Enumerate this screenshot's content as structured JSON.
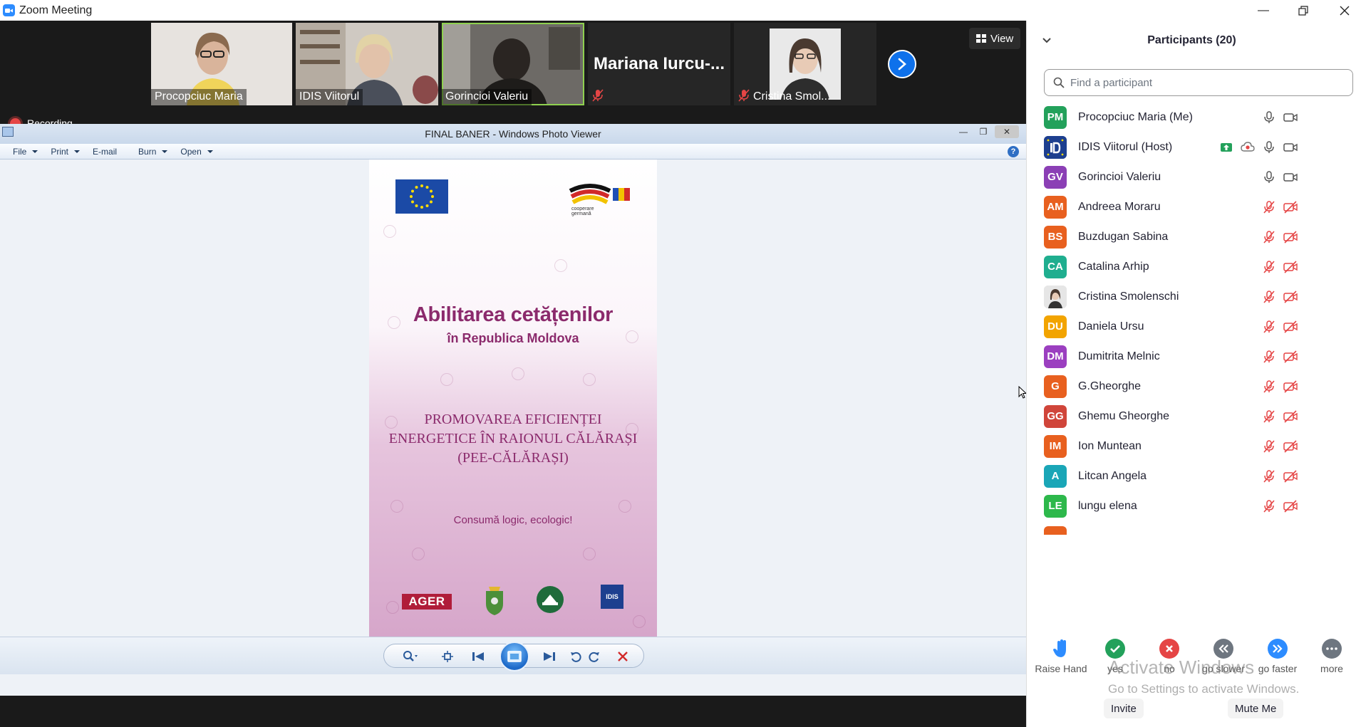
{
  "window": {
    "title": "Zoom Meeting"
  },
  "videos": [
    {
      "name": "Procopciuc Maria"
    },
    {
      "name": "IDIS Viitorul"
    },
    {
      "name": "Gorincioi Valeriu"
    },
    {
      "name": "Mariana Iurcu-..."
    },
    {
      "name": "Cristina Smol..."
    }
  ],
  "view_label": "View",
  "recording_label": "Recording",
  "photo_viewer": {
    "title": "FINAL BANER - Windows Photo Viewer",
    "menu": [
      "File",
      "Print",
      "E-mail",
      "Burn",
      "Open"
    ]
  },
  "poster": {
    "title": "Abilitarea cetățenilor",
    "subtitle": "în Republica Moldova",
    "project": "PROMOVAREA EFICIENȚEI ENERGETICE ÎN RAIONUL CĂLĂRAȘI (PEE-CĂLĂRAȘI)",
    "slogan": "Consumă logic, ecologic!",
    "ager": "AGER",
    "idis": "IDIS",
    "coop_line1": "cooperare",
    "coop_line2": "germană"
  },
  "participants_panel": {
    "title": "Participants (20)",
    "search_placeholder": "Find a participant",
    "participants": [
      {
        "initials": "PM",
        "name": "Procopciuc Maria (Me)",
        "color": "#23a15b",
        "muted": false,
        "video": true
      },
      {
        "initials": "",
        "name": "IDIS Viitorul (Host)",
        "color": "#1d3f8f",
        "muted": false,
        "video": true,
        "sharing": true
      },
      {
        "initials": "GV",
        "name": "Gorincioi Valeriu",
        "color": "#8b3fb5",
        "muted": false,
        "video": true
      },
      {
        "initials": "AM",
        "name": "Andreea Moraru",
        "color": "#e8601f",
        "muted": true,
        "video": false
      },
      {
        "initials": "BS",
        "name": "Buzdugan Sabina",
        "color": "#e8601f",
        "muted": true,
        "video": false
      },
      {
        "initials": "CA",
        "name": "Catalina Arhip",
        "color": "#1fae8f",
        "muted": true,
        "video": false
      },
      {
        "initials": "",
        "name": "Cristina Smolenschi",
        "color": "#cfcfcf",
        "muted": true,
        "video": false
      },
      {
        "initials": "DU",
        "name": "Daniela Ursu",
        "color": "#f2a400",
        "muted": true,
        "video": false
      },
      {
        "initials": "DM",
        "name": "Dumitrita Melnic",
        "color": "#9b3fc0",
        "muted": true,
        "video": false
      },
      {
        "initials": "G",
        "name": "G.Gheorghe",
        "color": "#e8601f",
        "muted": true,
        "video": false
      },
      {
        "initials": "GG",
        "name": "Ghemu Gheorghe",
        "color": "#d0453a",
        "muted": true,
        "video": false
      },
      {
        "initials": "IM",
        "name": "Ion Muntean",
        "color": "#e8601f",
        "muted": true,
        "video": false
      },
      {
        "initials": "A",
        "name": "Litcan Angela",
        "color": "#1aa6b7",
        "muted": true,
        "video": false
      },
      {
        "initials": "LE",
        "name": "lungu elena",
        "color": "#2db84b",
        "muted": true,
        "video": false
      }
    ],
    "reactions": [
      {
        "label": "Raise Hand"
      },
      {
        "label": "yes"
      },
      {
        "label": "no"
      },
      {
        "label": "go slower"
      },
      {
        "label": "go faster"
      },
      {
        "label": "more"
      }
    ],
    "invite_label": "Invite",
    "mute_me_label": "Mute Me"
  },
  "watermark": {
    "line1": "Activate Windows",
    "line2": "Go to Settings to activate Windows."
  }
}
